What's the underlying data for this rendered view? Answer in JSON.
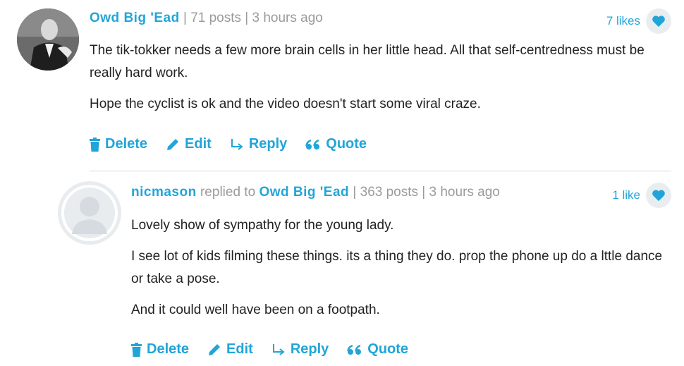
{
  "comments": [
    {
      "author": "Owd Big 'Ead",
      "meta": " | 71 posts | 3 hours ago",
      "likes": "7 likes",
      "paragraphs": [
        "The tik-tokker needs a few more brain cells in her little head. All that self-centredness must be really hard work.",
        "Hope the cyclist is ok and the video doesn't start some viral craze."
      ],
      "actions": {
        "delete": "Delete",
        "edit": "Edit",
        "reply": "Reply",
        "quote": "Quote"
      }
    },
    {
      "author": "nicmason",
      "replied_to_text": " replied to ",
      "replied_to": "Owd Big 'Ead",
      "meta": " | 363 posts | 3 hours ago",
      "likes": "1 like",
      "paragraphs": [
        "Lovely show of sympathy for the  young lady.",
        "I see lot of kids filming these things. its a thing they do.  prop the phone up do a lttle dance or take a pose.",
        "And it could well have been on a  footpath."
      ],
      "actions": {
        "delete": "Delete",
        "edit": "Edit",
        "reply": "Reply",
        "quote": "Quote"
      }
    }
  ],
  "colors": {
    "accent": "#21a5d8",
    "meta": "#9a9a9a",
    "text": "#222222"
  }
}
